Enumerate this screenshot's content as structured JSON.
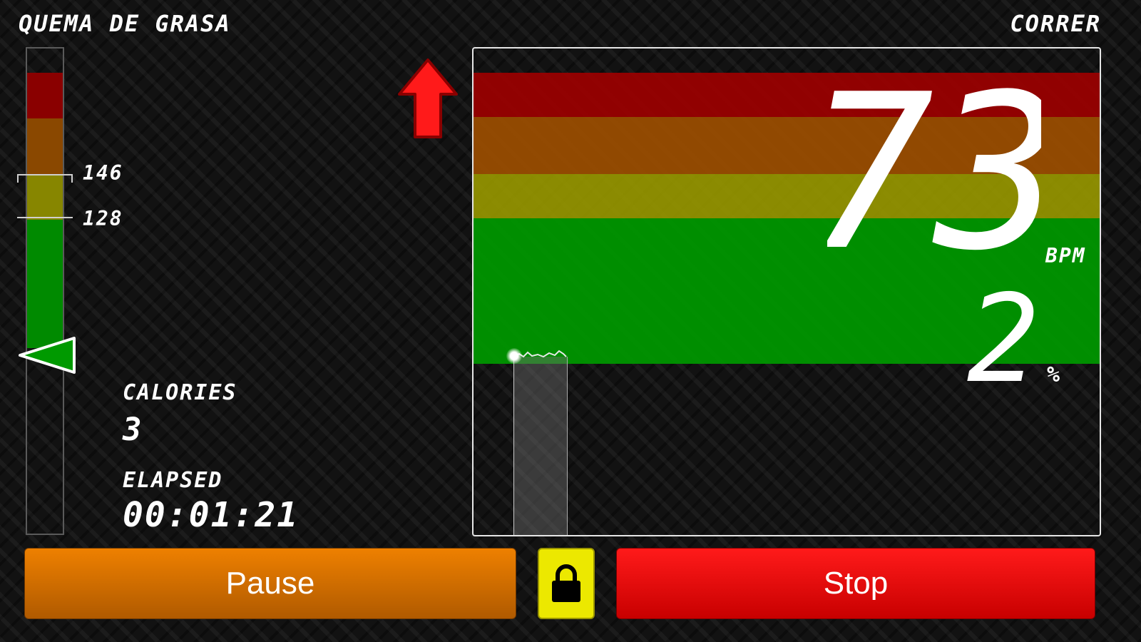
{
  "header": {
    "mode_title": "QUEMA DE GRASA",
    "activity": "CORRER"
  },
  "gauge": {
    "upper_limit": "146",
    "lower_limit": "128",
    "zone_colors": {
      "red": "#8a0000",
      "orange": "#8a4800",
      "yellow": "#878600",
      "green": "#008a00"
    }
  },
  "indicator": {
    "arrow_icon": "up-arrow-icon",
    "arrow_color": "#ff1a1a"
  },
  "stats": {
    "calories_label": "CALORIES",
    "calories_value": "3",
    "elapsed_label": "ELAPSED",
    "elapsed_value": "00:01:21"
  },
  "display": {
    "bpm_value": "73",
    "bpm_unit": "BPM",
    "percent_value": "2",
    "percent_unit": "%"
  },
  "controls": {
    "pause_label": "Pause",
    "lock_icon": "lock-icon",
    "stop_label": "Stop",
    "pause_color": "#ee8000",
    "stop_color": "#ff1a1a",
    "lock_color": "#ece800"
  }
}
